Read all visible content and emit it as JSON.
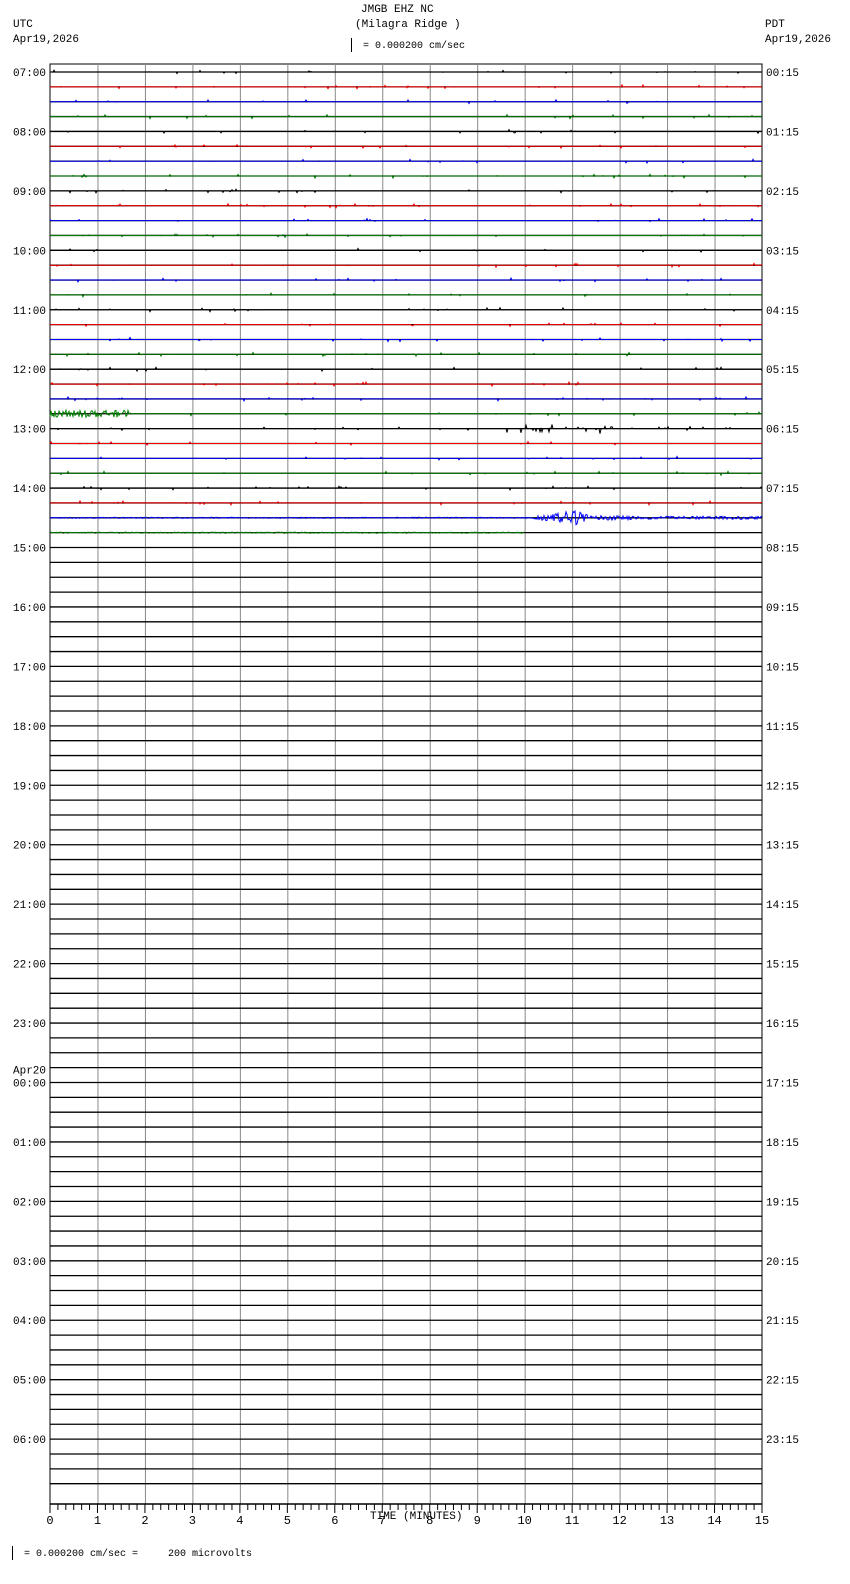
{
  "header": {
    "station": "JMGB EHZ NC",
    "location": "(Milagra Ridge )",
    "scale": "= 0.000200 cm/sec",
    "left_tz": "UTC",
    "left_date": "Apr19,2026",
    "right_tz": "PDT",
    "right_date": "Apr19,2026"
  },
  "footer": {
    "scale_note": "= 0.000200 cm/sec =     200 microvolts"
  },
  "chart_data": {
    "type": "line",
    "title": "JMGB EHZ NC (Milagra Ridge )",
    "xlabel": "TIME (MINUTES)",
    "xlim": [
      0,
      15
    ],
    "x_ticks": [
      "0",
      "1",
      "2",
      "3",
      "4",
      "5",
      "6",
      "7",
      "8",
      "9",
      "10",
      "11",
      "12",
      "13",
      "14",
      "15"
    ],
    "lines_per_hour": 4,
    "trace_colors": [
      "#000000",
      "#ff0000",
      "#0000ff",
      "#008000"
    ],
    "date_change_label": "Apr20",
    "utc_hours": [
      "07:00",
      "08:00",
      "09:00",
      "10:00",
      "11:00",
      "12:00",
      "13:00",
      "14:00",
      "15:00",
      "16:00",
      "17:00",
      "18:00",
      "19:00",
      "20:00",
      "21:00",
      "22:00",
      "23:00",
      "00:00",
      "01:00",
      "02:00",
      "03:00",
      "04:00",
      "05:00",
      "06:00"
    ],
    "pdt_hours": [
      "00:15",
      "01:15",
      "02:15",
      "03:15",
      "04:15",
      "05:15",
      "06:15",
      "07:15",
      "08:15",
      "09:15",
      "10:15",
      "11:15",
      "12:15",
      "13:15",
      "14:15",
      "15:15",
      "16:15",
      "17:15",
      "18:15",
      "19:15",
      "20:15",
      "21:15",
      "22:15",
      "23:15"
    ],
    "data_end": {
      "line_utc": "14:45",
      "minute": 10
    },
    "events": [
      {
        "line_utc": "12:45",
        "minute_start": 0,
        "minute_end": 1.7,
        "note": "noise burst"
      },
      {
        "line_utc": "13:00",
        "minute_start": 9.5,
        "minute_end": 11.9,
        "note": "small spikes"
      },
      {
        "line_utc": "14:30",
        "minute_start": 10.2,
        "minute_end": 15,
        "peak_minute": 11.0,
        "note": "local event"
      }
    ]
  }
}
